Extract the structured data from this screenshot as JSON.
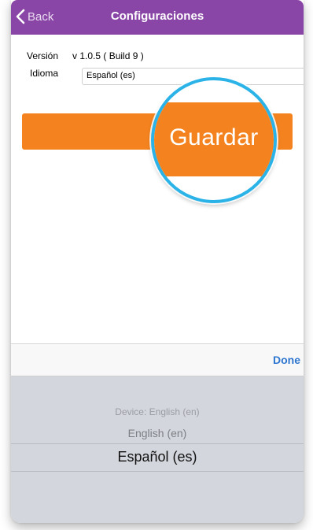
{
  "navbar": {
    "back_label": "Back",
    "title": "Configuraciones",
    "background_color": "#8a46a6",
    "back_icon": "chevron-left-icon"
  },
  "settings": {
    "version_label": "Versión",
    "version_value": "v 1.0.5 ( Build 9 )",
    "language_label": "Idioma",
    "language_value": "Español (es)"
  },
  "save_button": {
    "label": "Guardar",
    "color": "#f4831f",
    "highlight_ring_color": "#2bb3e8"
  },
  "picker_toolbar": {
    "done_label": "Done",
    "done_color": "#2e76d0"
  },
  "picker": {
    "options": [
      "Device: English (en)",
      "English (en)",
      "Español (es)"
    ],
    "selected_value": "Español (es)"
  }
}
